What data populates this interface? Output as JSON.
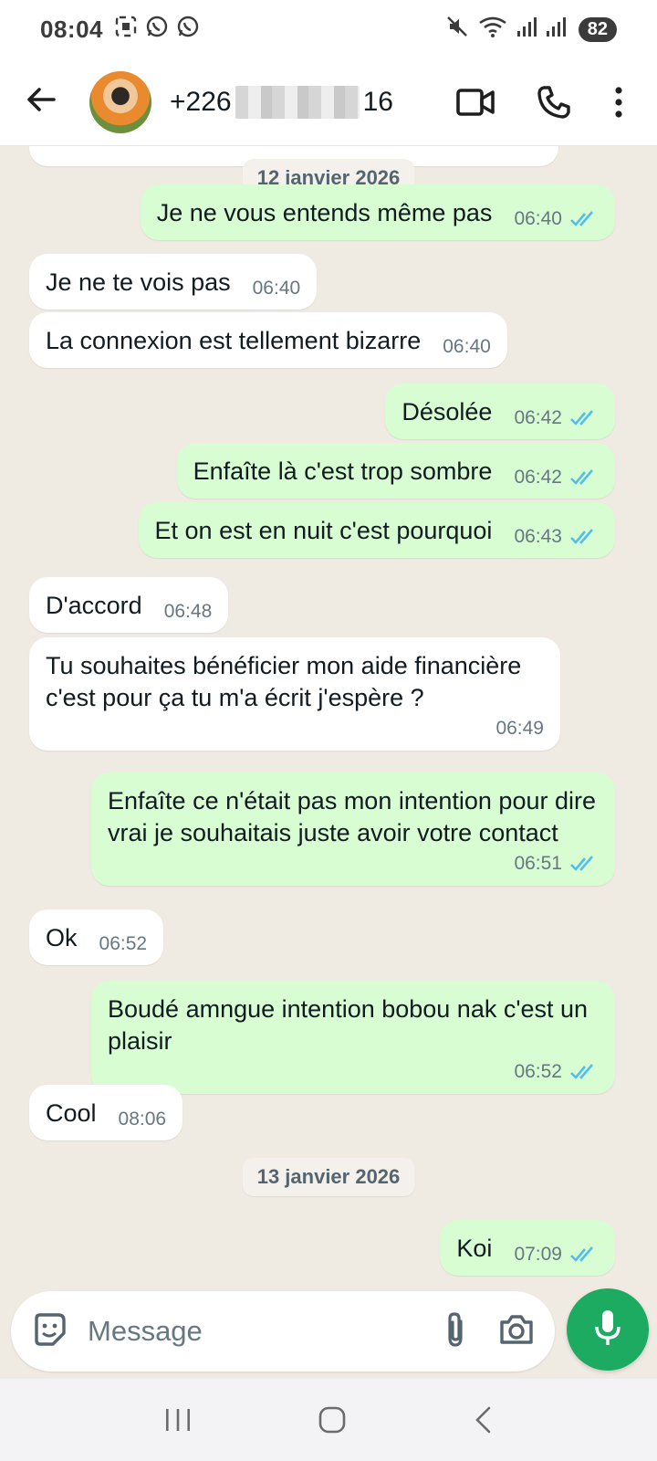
{
  "status_bar": {
    "time": "08:04",
    "battery": "82",
    "icons": [
      "screenshot-icon",
      "whatsapp-icon",
      "whatsapp-icon",
      "mute-icon",
      "wifi-icon",
      "signal-icon",
      "signal-icon"
    ]
  },
  "header": {
    "contact_prefix": "+226",
    "contact_suffix": "16",
    "icons": [
      "back-arrow-icon",
      "video-call-icon",
      "phone-icon",
      "more-vert-icon"
    ]
  },
  "chat": {
    "date_1": "12 janvier 2026",
    "date_2": "13 janvier 2026",
    "messages": [
      {
        "dir": "out",
        "text": "Je ne vous entends même pas",
        "time": "06:40"
      },
      {
        "dir": "in",
        "text": "Je ne te vois pas",
        "time": "06:40"
      },
      {
        "dir": "in",
        "text": "La connexion est tellement bizarre",
        "time": "06:40"
      },
      {
        "dir": "out",
        "text": "Désolée",
        "time": "06:42"
      },
      {
        "dir": "out",
        "text": "Enfaîte là c'est trop sombre",
        "time": "06:42"
      },
      {
        "dir": "out",
        "text": "Et on est en nuit c'est pourquoi",
        "time": "06:43"
      },
      {
        "dir": "in",
        "text": "D'accord",
        "time": "06:48"
      },
      {
        "dir": "in",
        "text": "Tu souhaites bénéficier mon aide financière c'est pour ça tu m'a écrit j'espère ?",
        "time": "06:49"
      },
      {
        "dir": "out",
        "text": "Enfaîte ce n'était pas mon intention pour dire vrai je souhaitais juste avoir votre contact",
        "time": "06:51"
      },
      {
        "dir": "in",
        "text": "Ok",
        "time": "06:52"
      },
      {
        "dir": "out",
        "text": "Boudé amngue intention bobou nak c'est un plaisir",
        "time": "06:52"
      },
      {
        "dir": "in",
        "text": "Cool",
        "time": "08:06"
      },
      {
        "dir": "out",
        "text": "Koi",
        "time": "07:09"
      }
    ]
  },
  "composer": {
    "placeholder": "Message",
    "icons": [
      "sticker-icon",
      "attach-icon",
      "camera-icon",
      "mic-icon"
    ]
  },
  "colors": {
    "chat_background": "#efeae2",
    "outgoing_bubble": "#d9fdd3",
    "incoming_bubble": "#ffffff",
    "read_ticks": "#53bdeb",
    "mic_button": "#1daa61"
  }
}
